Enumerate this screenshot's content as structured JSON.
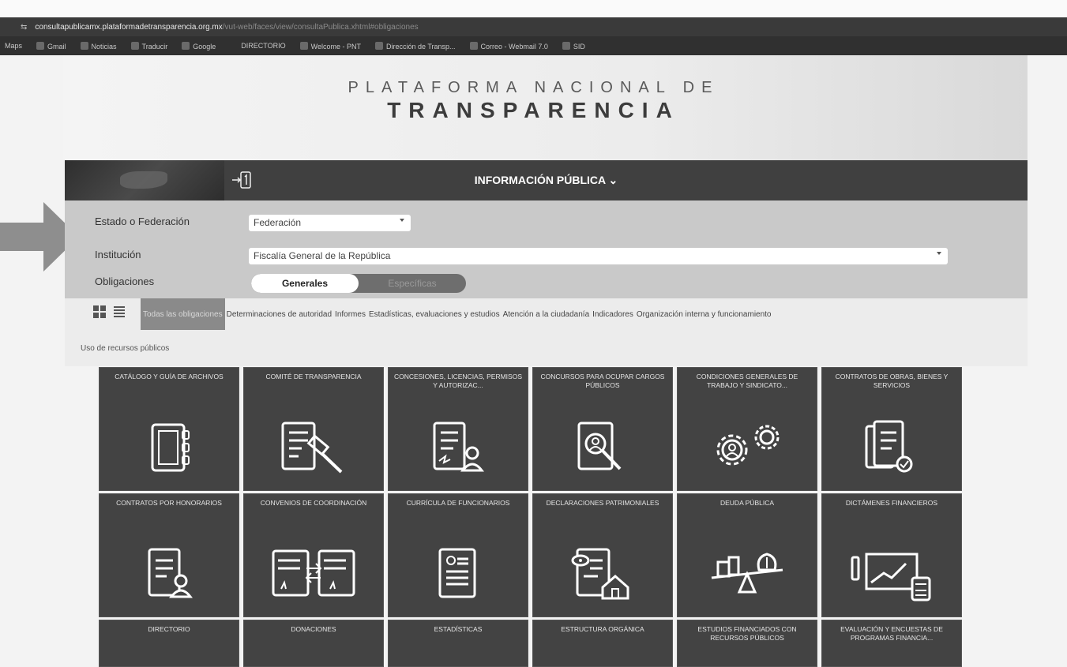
{
  "browser": {
    "url_host": "consultapublicamx.plataformadetransparencia.org.mx",
    "url_path": "/vut-web/faces/view/consultaPublica.xhtml#obligaciones",
    "bookmarks": [
      "Maps",
      "Gmail",
      "Noticias",
      "Traducir",
      "Google",
      "DIRECTORIO",
      "Welcome - PNT",
      "Dirección de Transp...",
      "Correo - Webmail 7.0",
      "SID"
    ]
  },
  "header": {
    "title_line1": "PLATAFORMA NACIONAL DE",
    "title_line2": "TRANSPARENCIA"
  },
  "nav": {
    "menu_label": "INFORMACIÓN PÚBLICA",
    "login_icon": "login-icon"
  },
  "filters": {
    "estado_label": "Estado o Federación",
    "estado_value": "Federación",
    "institucion_label": "Institución",
    "institucion_value": "Fiscalía General de la República",
    "obligaciones_label": "Obligaciones",
    "toggle_on": "Generales",
    "toggle_off": "Específicas"
  },
  "tabs": [
    "Todas las obligaciones",
    "Determinaciones de autoridad",
    "Informes",
    "Estadísticas, evaluaciones y estudios",
    "Atención a la ciudadanía",
    "Indicadores",
    "Organización interna y funcionamiento"
  ],
  "tab_second_line": "Uso de recursos públicos",
  "tiles": [
    {
      "label": "CATÁLOGO Y GUÍA DE ARCHIVOS",
      "icon": "binder-icon"
    },
    {
      "label": "COMITÉ DE TRANSPARENCIA",
      "icon": "gavel-document-icon"
    },
    {
      "label": "CONCESIONES, LICENCIAS, PERMISOS Y AUTORIZAC...",
      "icon": "signed-document-user-icon"
    },
    {
      "label": "CONCURSOS PARA OCUPAR CARGOS PÚBLICOS",
      "icon": "search-user-document-icon"
    },
    {
      "label": "CONDICIONES GENERALES DE TRABAJO Y SINDICATO...",
      "icon": "gears-icon"
    },
    {
      "label": "CONTRATOS DE OBRAS, BIENES Y SERVICIOS",
      "icon": "documents-check-icon"
    },
    {
      "label": "CONTRATOS POR HONORARIOS",
      "icon": "document-user-icon"
    },
    {
      "label": "CONVENIOS DE COORDINACIÓN",
      "icon": "exchange-documents-icon"
    },
    {
      "label": "CURRÍCULA DE FUNCIONARIOS",
      "icon": "resume-icon"
    },
    {
      "label": "DECLARACIONES PATRIMONIALES",
      "icon": "house-document-icon"
    },
    {
      "label": "DEUDA PÚBLICA",
      "icon": "balance-icon"
    },
    {
      "label": "DICTÁMENES FINANCIEROS",
      "icon": "financial-chart-icon"
    },
    {
      "label": "DIRECTORIO",
      "icon": ""
    },
    {
      "label": "DONACIONES",
      "icon": ""
    },
    {
      "label": "ESTADÍSTICAS",
      "icon": ""
    },
    {
      "label": "ESTRUCTURA ORGÁNICA",
      "icon": ""
    },
    {
      "label": "ESTUDIOS FINANCIADOS CON RECURSOS PÚBLICOS",
      "icon": ""
    },
    {
      "label": "EVALUACIÓN Y ENCUESTAS DE PROGRAMAS FINANCIA...",
      "icon": ""
    }
  ]
}
